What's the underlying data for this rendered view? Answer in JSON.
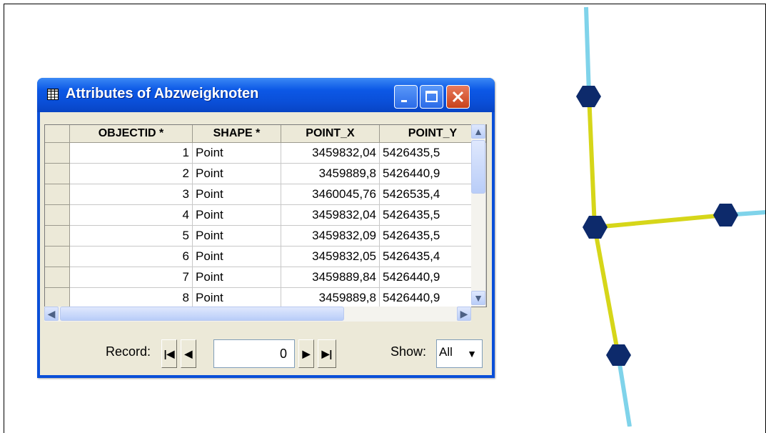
{
  "window": {
    "title": "Attributes of Abzweigknoten",
    "titlebar_color": "#0a4fd8",
    "icon": "table-icon",
    "controls": [
      "minimize-icon",
      "maximize-icon",
      "close-icon"
    ]
  },
  "table": {
    "columns": [
      "OBJECTID *",
      "SHAPE *",
      "POINT_X",
      "POINT_Y"
    ],
    "rows": [
      {
        "objectid": "1",
        "shape": "Point",
        "x": "3459832,04",
        "y": "5426435,5"
      },
      {
        "objectid": "2",
        "shape": "Point",
        "x": "3459889,8",
        "y": "5426440,9"
      },
      {
        "objectid": "3",
        "shape": "Point",
        "x": "3460045,76",
        "y": "5426535,4"
      },
      {
        "objectid": "4",
        "shape": "Point",
        "x": "3459832,04",
        "y": "5426435,5"
      },
      {
        "objectid": "5",
        "shape": "Point",
        "x": "3459832,09",
        "y": "5426435,5"
      },
      {
        "objectid": "6",
        "shape": "Point",
        "x": "3459832,05",
        "y": "5426435,4"
      },
      {
        "objectid": "7",
        "shape": "Point",
        "x": "3459889,84",
        "y": "5426440,9"
      },
      {
        "objectid": "8",
        "shape": "Point",
        "x": "3459889,8",
        "y": "5426440,9"
      }
    ]
  },
  "statusbar": {
    "record_label": "Record:",
    "record_value": "0",
    "show_label": "Show:",
    "show_value": "All",
    "nav_icons": [
      "first-record-icon",
      "previous-record-icon",
      "next-record-icon",
      "last-record-icon"
    ]
  },
  "map": {
    "line_colors": {
      "network": "#7fd3ea",
      "selected": "#d6d619",
      "node": "#0d2a6b"
    },
    "node_count": 4
  }
}
